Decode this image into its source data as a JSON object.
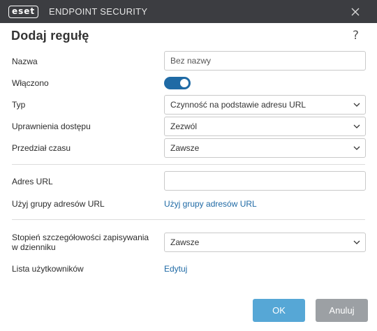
{
  "titlebar": {
    "logo_text": "eset",
    "product_name": "ENDPOINT SECURITY"
  },
  "dialog": {
    "title": "Dodaj regułę",
    "help_glyph": "?"
  },
  "form": {
    "name_label": "Nazwa",
    "name_placeholder": "Bez nazwy",
    "name_value": "",
    "enabled_label": "Włączono",
    "enabled": true,
    "type_label": "Typ",
    "type_value": "Czynność na podstawie adresu URL",
    "access_label": "Uprawnienia dostępu",
    "access_value": "Zezwól",
    "time_label": "Przedział czasu",
    "time_value": "Zawsze",
    "url_label": "Adres URL",
    "url_value": "",
    "url_group_label": "Użyj grupy adresów URL",
    "url_group_link": "Użyj grupy adresów URL",
    "log_label_line1": "Stopień szczegółowości zapisywania",
    "log_label_line2": "w dzienniku",
    "log_value": "Zawsze",
    "users_label": "Lista użytkowników",
    "users_link": "Edytuj"
  },
  "buttons": {
    "ok": "OK",
    "cancel": "Anuluj"
  },
  "colors": {
    "titlebar_bg": "#3c3d41",
    "accent": "#1f6aa5",
    "ok_button": "#56a7d6",
    "cancel_button": "#9ca0a4"
  },
  "icons": {
    "close": "close-icon",
    "help": "help-icon",
    "dropdown": "chevron-down-icon"
  }
}
